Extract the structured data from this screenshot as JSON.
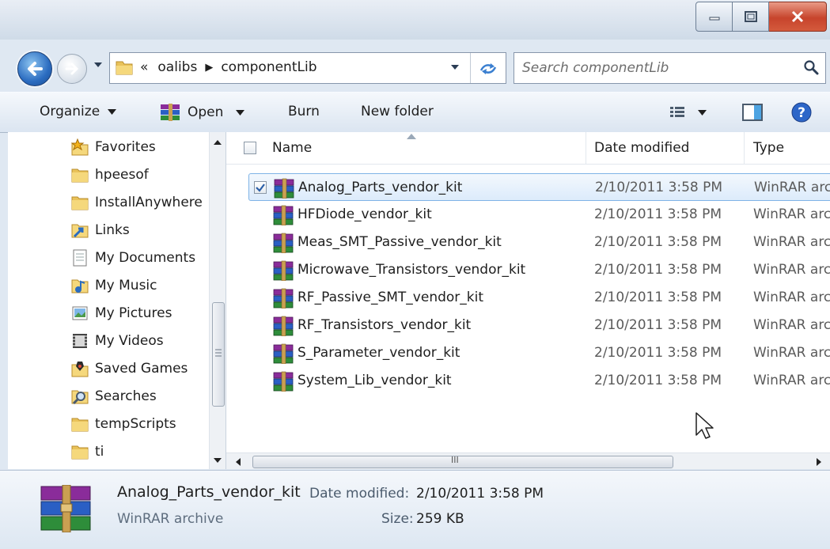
{
  "address": {
    "overflow": "«",
    "crumbs": [
      "oalibs",
      "componentLib"
    ]
  },
  "search": {
    "placeholder": "Search componentLib"
  },
  "toolbar": {
    "organize": "Organize",
    "open": "Open",
    "burn": "Burn",
    "new_folder": "New folder"
  },
  "nav": {
    "items": [
      {
        "label": "Favorites",
        "icon": "star-folder-icon"
      },
      {
        "label": "hpeesof",
        "icon": "folder-icon"
      },
      {
        "label": "InstallAnywhere",
        "icon": "folder-icon"
      },
      {
        "label": "Links",
        "icon": "links-folder-icon"
      },
      {
        "label": "My Documents",
        "icon": "documents-icon"
      },
      {
        "label": "My Music",
        "icon": "music-icon"
      },
      {
        "label": "My Pictures",
        "icon": "pictures-icon"
      },
      {
        "label": "My Videos",
        "icon": "videos-icon"
      },
      {
        "label": "Saved Games",
        "icon": "saved-games-icon"
      },
      {
        "label": "Searches",
        "icon": "searches-icon"
      },
      {
        "label": "tempScripts",
        "icon": "folder-icon"
      },
      {
        "label": "ti",
        "icon": "folder-icon"
      }
    ]
  },
  "columns": {
    "name": "Name",
    "date": "Date modified",
    "type": "Type"
  },
  "files": [
    {
      "name": "Analog_Parts_vendor_kit",
      "date": "2/10/2011 3:58 PM",
      "type": "WinRAR archive",
      "selected": true
    },
    {
      "name": "HFDiode_vendor_kit",
      "date": "2/10/2011 3:58 PM",
      "type": "WinRAR archive",
      "selected": false
    },
    {
      "name": "Meas_SMT_Passive_vendor_kit",
      "date": "2/10/2011 3:58 PM",
      "type": "WinRAR archive",
      "selected": false
    },
    {
      "name": "Microwave_Transistors_vendor_kit",
      "date": "2/10/2011 3:58 PM",
      "type": "WinRAR archive",
      "selected": false
    },
    {
      "name": "RF_Passive_SMT_vendor_kit",
      "date": "2/10/2011 3:58 PM",
      "type": "WinRAR archive",
      "selected": false
    },
    {
      "name": "RF_Transistors_vendor_kit",
      "date": "2/10/2011 3:58 PM",
      "type": "WinRAR archive",
      "selected": false
    },
    {
      "name": "S_Parameter_vendor_kit",
      "date": "2/10/2011 3:58 PM",
      "type": "WinRAR archive",
      "selected": false
    },
    {
      "name": "System_Lib_vendor_kit",
      "date": "2/10/2011 3:58 PM",
      "type": "WinRAR archive",
      "selected": false
    }
  ],
  "details": {
    "name": "Analog_Parts_vendor_kit",
    "type": "WinRAR archive",
    "date_label": "Date modified:",
    "date": "2/10/2011 3:58 PM",
    "size_label": "Size:",
    "size": "259 KB"
  },
  "hscroll_grip": "III",
  "colors": {
    "accent": "#2b6cc0",
    "selection_border": "#7fb3e6",
    "close": "#c7442c"
  }
}
